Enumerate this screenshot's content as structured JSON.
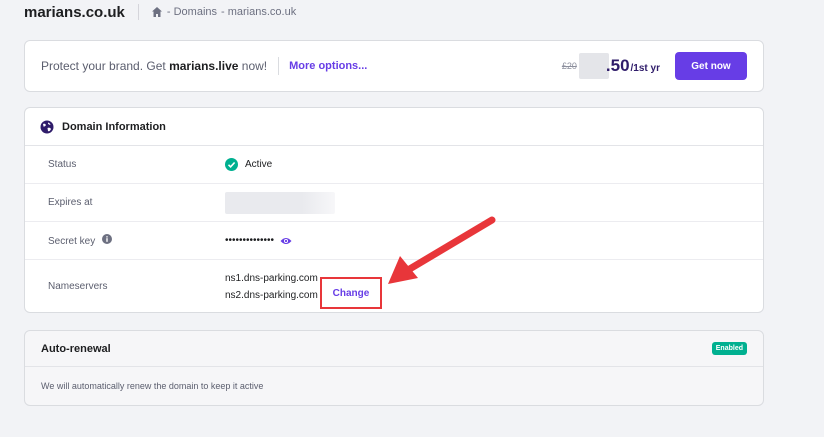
{
  "header": {
    "site_title": "marians.co.uk",
    "breadcrumb": [
      "- Domains",
      "- marians.co.uk"
    ]
  },
  "promo": {
    "text_prefix": "Protect your brand. Get ",
    "domain": "marians.live",
    "text_suffix": " now!",
    "more_options": "More options...",
    "old_price": "£20",
    "price": ".50",
    "per": "/1st yr",
    "cta": "Get now"
  },
  "domain_info": {
    "title": "Domain Information",
    "status_label": "Status",
    "status_value": "Active",
    "expires_label": "Expires at",
    "secret_label": "Secret key",
    "secret_value": "••••••••••••••",
    "nameservers_label": "Nameservers",
    "ns1": "ns1.dns-parking.com",
    "ns2": "ns2.dns-parking.com",
    "change": "Change"
  },
  "auto_renewal": {
    "title": "Auto-renewal",
    "badge": "Enabled",
    "text": "We will automatically renew the domain to keep it active"
  },
  "colors": {
    "accent": "#673de6",
    "success": "#00b090",
    "highlight": "#e8363a"
  }
}
